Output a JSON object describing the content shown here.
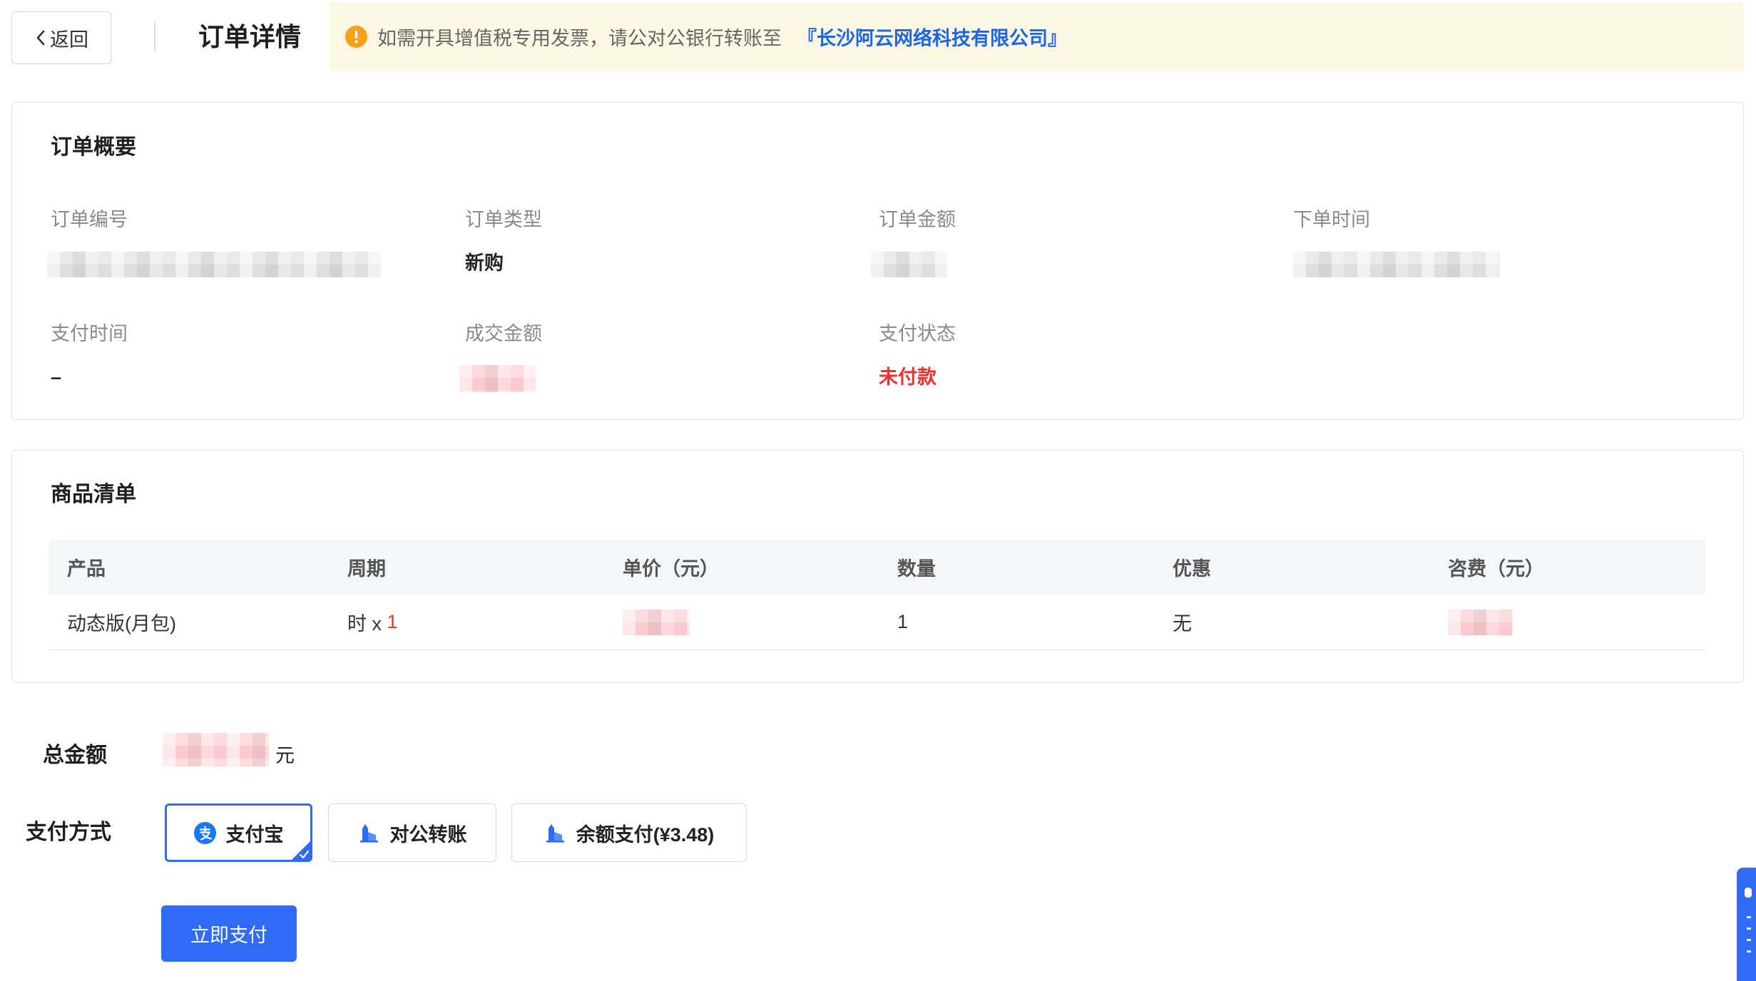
{
  "header": {
    "back_label": "返回",
    "title": "订单详情",
    "notice_text": "如需开具增值税专用发票，请公对公银行转账至",
    "notice_company": "『长沙阿云网络科技有限公司』",
    "notice_icon": "warning-icon"
  },
  "summary": {
    "title": "订单概要",
    "order_no_label": "订单编号",
    "order_type_label": "订单类型",
    "order_type_value": "新购",
    "order_amount_label": "订单金额",
    "order_time_label": "下单时间",
    "pay_time_label": "支付时间",
    "pay_time_value": "–",
    "deal_amount_label": "成交金额",
    "pay_status_label": "支付状态",
    "pay_status_value": "未付款"
  },
  "products": {
    "title": "商品清单",
    "columns": [
      "产品",
      "周期",
      "单价（元）",
      "数量",
      "优惠",
      "咨费（元）"
    ],
    "rows": [
      {
        "product": "动态版(月包)",
        "period_prefix": "时 x ",
        "period_count": "1",
        "quantity": "1",
        "discount": "无"
      }
    ]
  },
  "total": {
    "label": "总金额",
    "unit": "元"
  },
  "payment": {
    "label": "支付方式",
    "methods": [
      {
        "label": "支付宝",
        "icon": "alipay-icon",
        "selected": true
      },
      {
        "label": "对公转账",
        "icon": "bank-icon",
        "selected": false
      },
      {
        "label": "余额支付(¥3.48)",
        "icon": "bank-icon",
        "selected": false
      }
    ],
    "submit_label": "立即支付"
  },
  "colors": {
    "primary": "#2f6bf6",
    "danger": "#f0302e",
    "notice_bg": "#fdf8e4",
    "notice_icon": "#f5a11b",
    "link": "#1a66e8"
  }
}
